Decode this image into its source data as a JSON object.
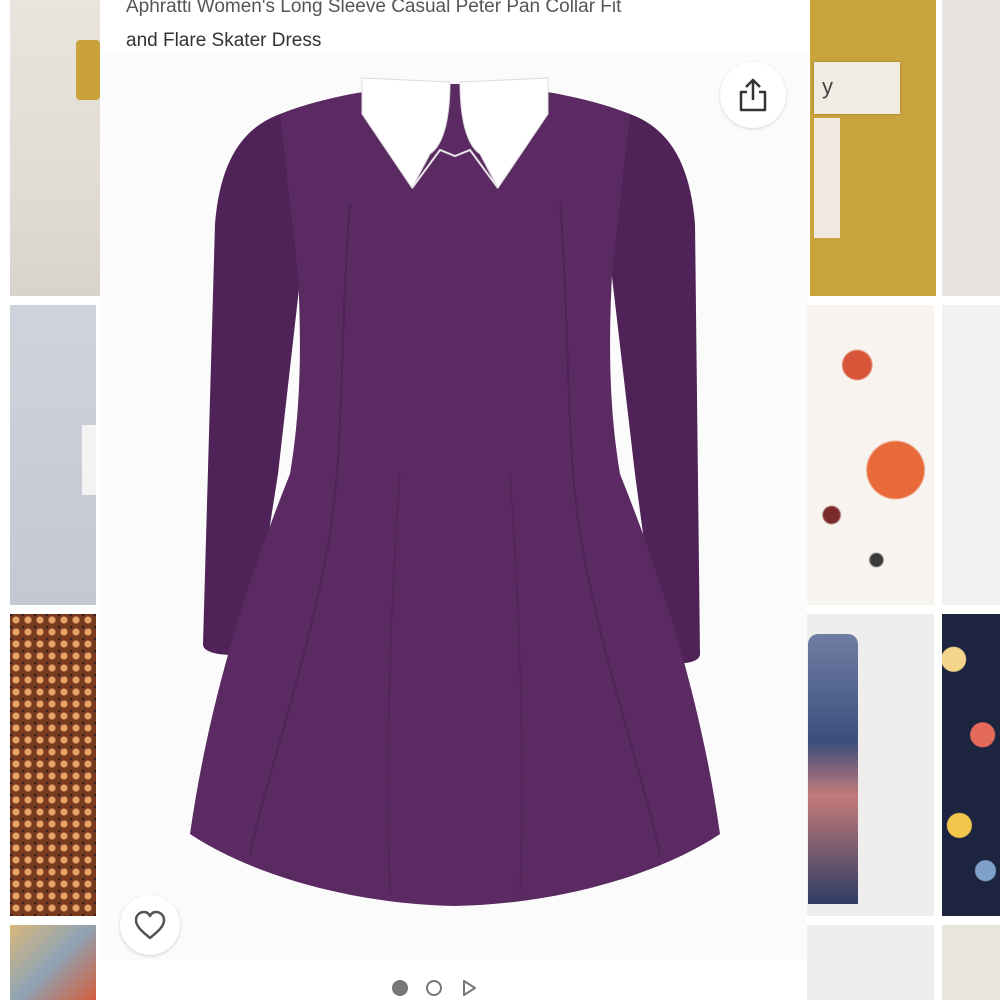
{
  "product": {
    "title_line1": "Aphratti Women's Long Sleeve Casual Peter Pan Collar Fit",
    "title_line2": "and Flare Skater Dress",
    "dress_color": "#5b2a62",
    "collar_color": "#ffffff"
  },
  "actions": {
    "share_icon": "share-icon",
    "favorite_icon": "heart-outline-icon"
  },
  "carousel": {
    "items": [
      {
        "type": "image",
        "active": true
      },
      {
        "type": "image",
        "active": false
      },
      {
        "type": "video",
        "active": false
      }
    ]
  },
  "background_tiles": {
    "tile_label_text": "y"
  }
}
